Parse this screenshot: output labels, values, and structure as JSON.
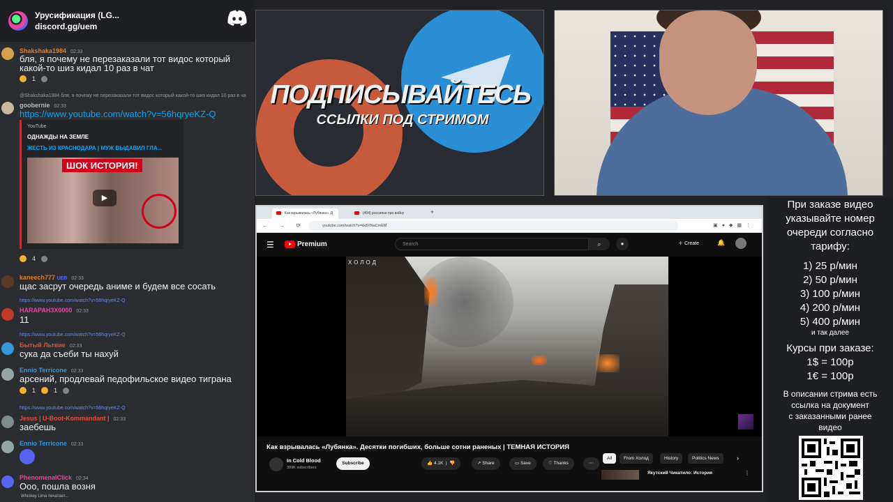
{
  "chat": {
    "server_name": "Урусификация (LG...",
    "server_invite": "discord.gg/uem",
    "messages": [
      {
        "user": "Shakshaka1984",
        "time": "02:33",
        "color": "#e67e22",
        "text1": "бля, я почему не перезаказали тот видос который",
        "text2": "какой-то шиз кидал 10 раз в чат",
        "react_count": "1"
      },
      {
        "reply": "@Shakshaka1984 бля, я почему не перезаказали тот видос который какой-то шиз кидал 10 раз в ча",
        "user": "goobernie",
        "time": "02:33",
        "color": "#b5bac1",
        "link": "https://www.youtube.com/watch?v=56hqryeKZ-Q"
      },
      {
        "user": "kaneech777",
        "badge": "UEB",
        "time": "02:33",
        "color": "#e67e22",
        "text1": "щас засрут очередь аниме и будем все сосать"
      },
      {
        "reply_link": "https://www.youtube.com/watch?v=56hqryeKZ-Q",
        "user": "HARAPAH3X0000",
        "time": "02:33",
        "color": "#eb459e",
        "text1": "11"
      },
      {
        "reply_link": "https://www.youtube.com/watch?v=56hqryeKZ-Q",
        "user": "Бытый Льтвие",
        "time": "02:33",
        "color": "#e74c3c",
        "text1": "сука да съеби ты нахуй"
      },
      {
        "user": "Ennio Terricone",
        "time": "02:33",
        "color": "#3498db",
        "text1": "арсений, продлевай педофильское видео тиграна",
        "r1": "1",
        "r2": "1"
      },
      {
        "reply_link": "https://www.youtube.com/watch?v=56hqryeKZ-Q",
        "user": "Jesus | U-Boot-Kommandant |",
        "time": "02:33",
        "color": "#e74c3c",
        "text1": "заебешь"
      },
      {
        "user": "Ennio Terricone",
        "time": "02:33",
        "color": "#3498db"
      },
      {
        "user": "PhenomenalClick",
        "time": "02:34",
        "color": "#eb459e",
        "text1": "Ооо, пошла возня"
      }
    ],
    "embed": {
      "source": "YouTube",
      "title": "ОДНАЖДЫ НА ЗЕМЛЕ",
      "link": "ЖЕСТЬ ИЗ КРАСНОДАРА | МУЖ ВЫДАВИЛ ГЛА...",
      "thumb_text": "ШОК ИСТОРИЯ!"
    },
    "react_embed_count": "4",
    "typing": "Whiskey Lima печатает..."
  },
  "promo": {
    "headline": "ПОДПИСЫВАЙТЕСЬ",
    "subline": "ССЫЛКИ ПОД СТРИМОМ"
  },
  "browser": {
    "tabs": [
      {
        "label": "Как взрывалась «Лубянка». Д"
      },
      {
        "label": "(404) россияне про войну"
      }
    ],
    "url": "youtube.com/watch?v=kk8XNaCmEM"
  },
  "youtube": {
    "logo": "Premium",
    "search_placeholder": "Search",
    "create": "Create",
    "watermark": "ХОЛОД",
    "title": "Как взрывалась «Лубянка». Десятки погибших, больше сотни раненых | ТЕМНАЯ ИСТОРИЯ",
    "channel": "In Cold Blood",
    "subs": "399K subscribers",
    "subscribe": "Subscribe",
    "likes": "4.1K",
    "share": "Share",
    "save": "Save",
    "thanks": "Thanks",
    "chips": [
      "All",
      "From Холод",
      "History",
      "Politics News"
    ],
    "rec_title": "Якутский Чикатило: История"
  },
  "prices": {
    "header": [
      "При заказе видео",
      "указывайте номер",
      "очереди согласно",
      "тарифу:"
    ],
    "tiers": [
      "1) 25 р/мин",
      "2) 50 р/мин",
      "3) 100 р/мин",
      "4) 200 р/мин",
      "5) 400 р/мин"
    ],
    "more": "и так далее",
    "rates_title": "Курсы при заказе:",
    "rates": [
      "1$ = 100р",
      "1€ = 100р"
    ],
    "desc": [
      "В описании стрима есть",
      "ссылка на документ",
      "с заказанными ранее",
      "видео"
    ]
  },
  "colors": {
    "discord_bg": "#2b2d31",
    "youtube_red": "#ff0000",
    "link_blue": "#00a8fc"
  }
}
